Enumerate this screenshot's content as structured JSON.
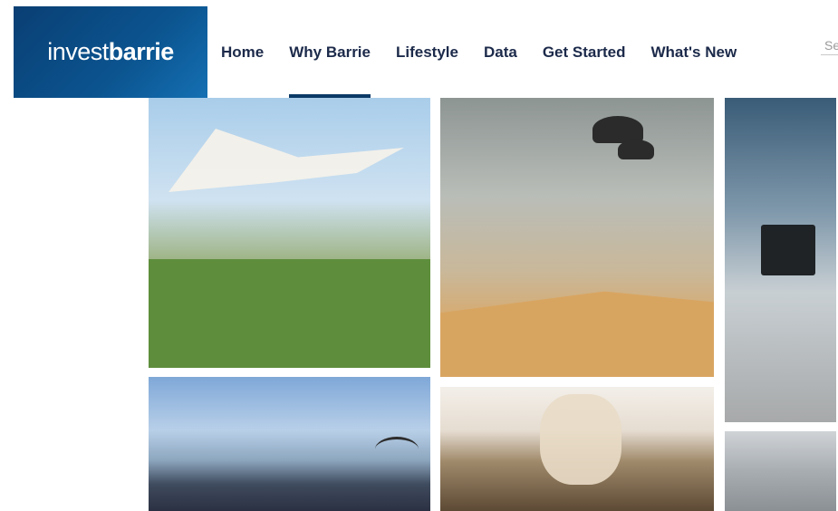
{
  "logo": {
    "light": "invest",
    "bold": "barrie"
  },
  "nav": {
    "items": [
      {
        "label": "Home",
        "active": false
      },
      {
        "label": "Why Barrie",
        "active": true
      },
      {
        "label": "Lifestyle",
        "active": false
      },
      {
        "label": "Data",
        "active": false
      },
      {
        "label": "Get Started",
        "active": false
      },
      {
        "label": "What's New",
        "active": false
      }
    ]
  },
  "search": {
    "placeholder": "Se"
  },
  "colors": {
    "brand": "#0b4d86",
    "nav_text": "#1c2a4a",
    "active_underline": "#0b3a66"
  },
  "photos": [
    {
      "id": "outdoor-concert"
    },
    {
      "id": "office-meeting"
    },
    {
      "id": "office-window"
    },
    {
      "id": "rooftop-gathering"
    },
    {
      "id": "restaurant-interior"
    },
    {
      "id": "partial-image"
    }
  ]
}
